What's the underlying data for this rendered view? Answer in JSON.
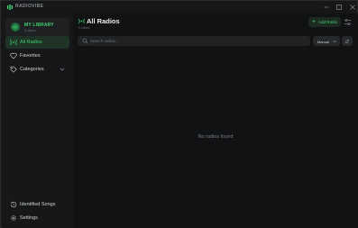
{
  "app": {
    "name": "RADIOVIBE",
    "accent": "#3fd36f"
  },
  "window_controls": {
    "minimize_icon": "minimize-icon",
    "maximize_icon": "maximize-icon",
    "close_icon": "close-icon"
  },
  "sidebar": {
    "library": {
      "title": "MY LIBRARY",
      "subtitle": "0 radios"
    },
    "items": [
      {
        "label": "All Radios",
        "icon": "radio-waves-icon",
        "active": true
      },
      {
        "label": "Favorites",
        "icon": "heart-icon",
        "active": false
      },
      {
        "label": "Categories",
        "icon": "tag-icon",
        "active": false,
        "expandable": true
      }
    ],
    "bottom_items": [
      {
        "label": "Identified Songs",
        "icon": "history-icon"
      },
      {
        "label": "Settings",
        "icon": "gear-icon"
      }
    ]
  },
  "main": {
    "title": "All Radios",
    "subtitle": "0 radios",
    "add_button_label": "Add Radio",
    "search_placeholder": "Search radios...",
    "search_value": "",
    "sort_value": "Manual",
    "empty_message": "No radios found"
  }
}
